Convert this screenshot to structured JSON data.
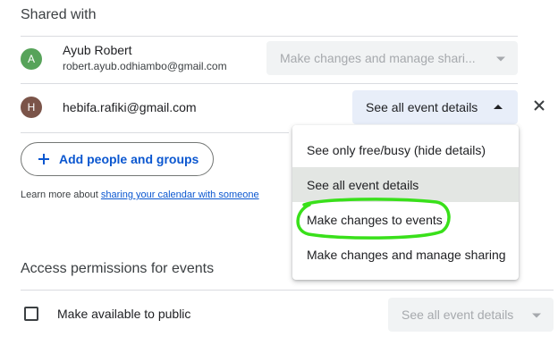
{
  "shared_with": {
    "title": "Shared with",
    "people": [
      {
        "initial": "A",
        "avatar_color": "#57a35a",
        "name": "Ayub Robert",
        "email": "robert.ayub.odhiambo@gmail.com",
        "permission": "Make changes and manage shari..."
      },
      {
        "initial": "H",
        "avatar_color": "#7b5449",
        "email": "hebifa.rafiki@gmail.com",
        "permission": "See all event details"
      }
    ]
  },
  "add_button": {
    "label": "Add people and groups"
  },
  "learn_more": {
    "prefix": "Learn more about ",
    "link": "sharing your calendar with someone"
  },
  "dropdown_menu": {
    "items": [
      {
        "label": "See only free/busy (hide details)",
        "selected": false
      },
      {
        "label": "See all event details",
        "selected": true
      },
      {
        "label": "Make changes to events",
        "selected": false,
        "highlighted": true
      },
      {
        "label": "Make changes and manage sharing",
        "selected": false
      }
    ]
  },
  "access_permissions": {
    "title": "Access permissions for events",
    "public_checkbox_label": "Make available to public",
    "public_checkbox_checked": false,
    "public_permission": "See all event details"
  },
  "colors": {
    "accent_blue": "#0b57d0",
    "highlight_green": "#39e01a",
    "active_select_bg": "#e8eef9"
  }
}
